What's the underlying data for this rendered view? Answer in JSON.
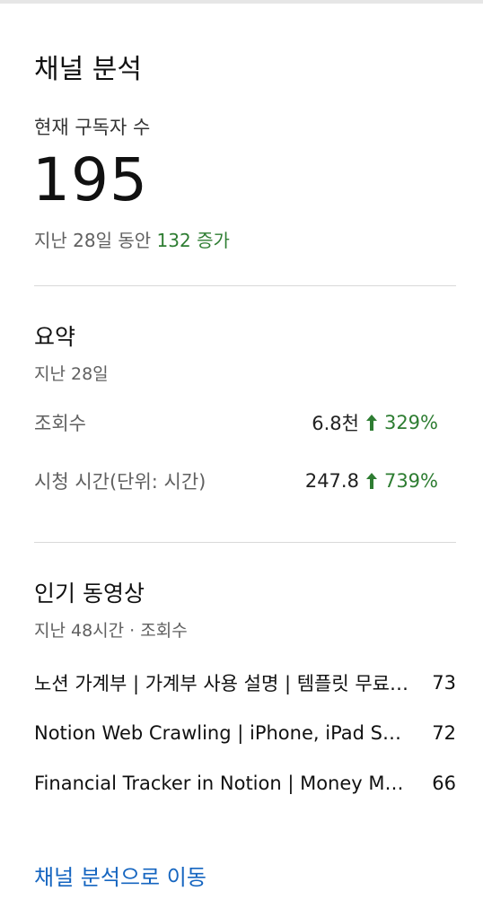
{
  "header": {
    "title": "채널 분석"
  },
  "subscribers": {
    "label": "현재 구독자 수",
    "count": "195",
    "period_prefix": "지난 28일 동안",
    "increase": "132 증가"
  },
  "summary": {
    "title": "요약",
    "period": "지난 28일",
    "metrics": [
      {
        "label": "조회수",
        "value": "6.8천",
        "change": "329%"
      },
      {
        "label": "시청 시간(단위: 시간)",
        "value": "247.8",
        "change": "739%"
      }
    ]
  },
  "top_videos": {
    "title": "인기 동영상",
    "period": "지난 48시간 · 조회수",
    "items": [
      {
        "title": "노션 가계부 | 가계부 사용 설명 | 템플릿 무료 공유",
        "views": "73"
      },
      {
        "title": "Notion Web Crawling | iPhone, iPad Shortcuts",
        "views": "72"
      },
      {
        "title": "Financial Tracker in Notion | Money Management",
        "views": "66"
      }
    ]
  },
  "footer": {
    "link_label": "채널 분석으로 이동"
  },
  "colors": {
    "accent_green": "#2e7d32",
    "link_blue": "#1565c0",
    "arrow-icon": "up-arrow-icon"
  }
}
